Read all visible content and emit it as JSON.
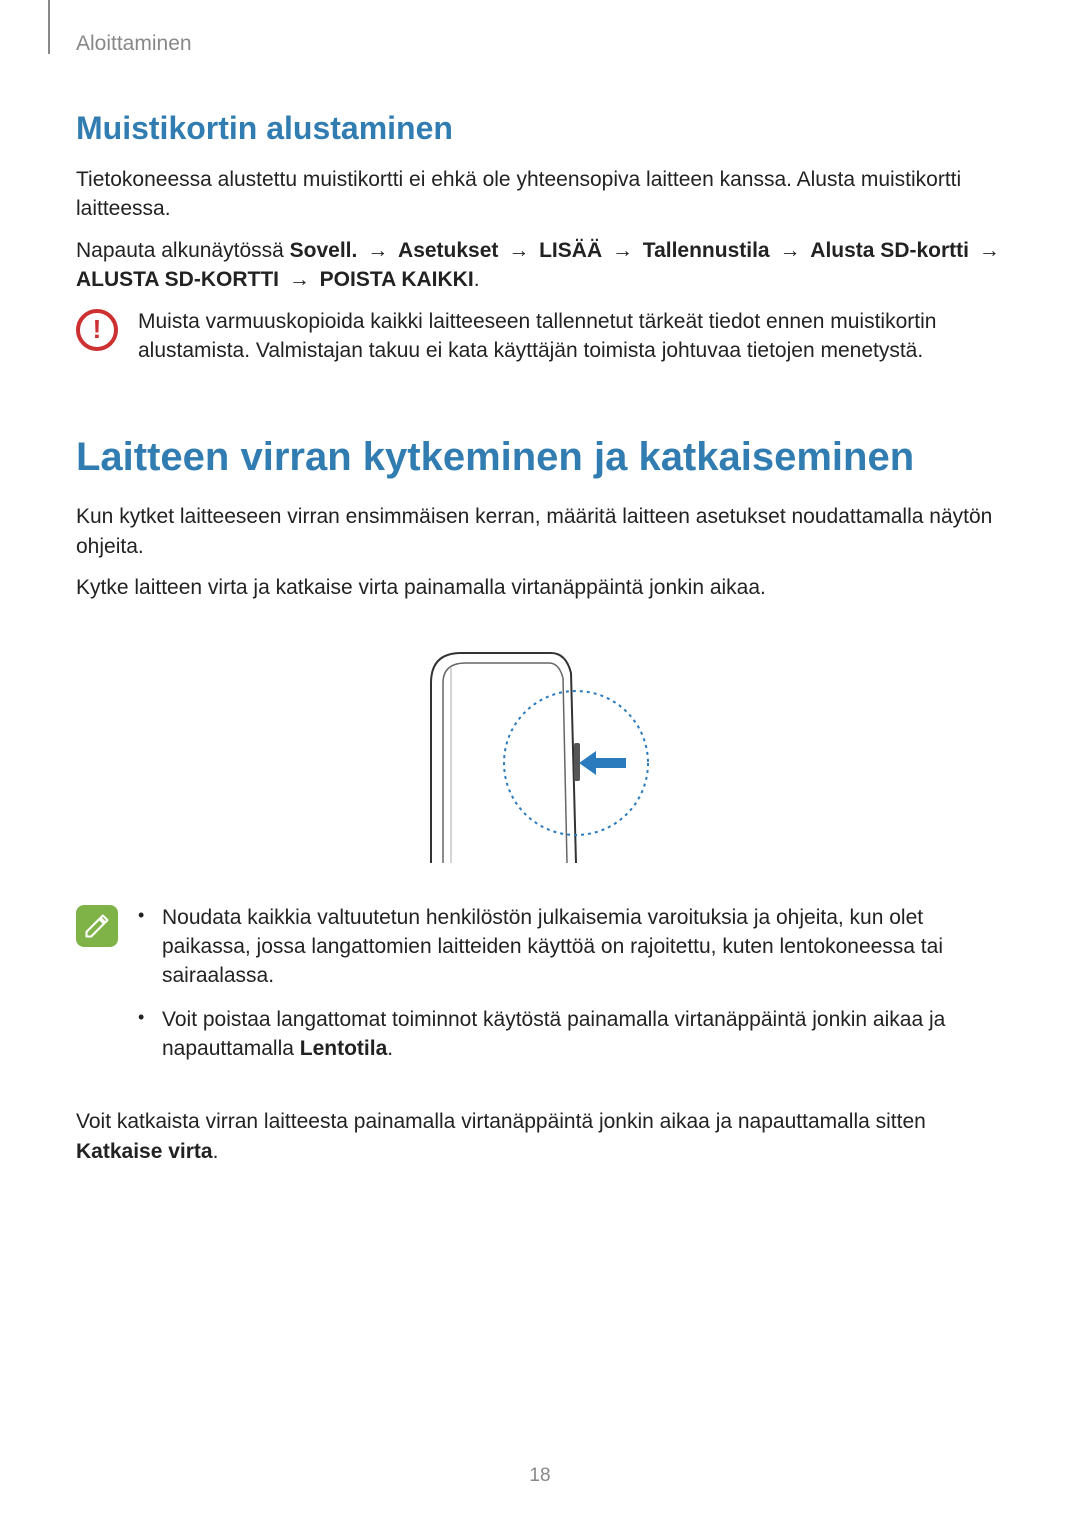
{
  "header": {
    "section": "Aloittaminen"
  },
  "section1": {
    "title": "Muistikortin alustaminen",
    "p1": "Tietokoneessa alustettu muistikortti ei ehkä ole yhteensopiva laitteen kanssa. Alusta muistikortti laitteessa.",
    "p2_prefix": "Napauta alkunäytössä ",
    "p2_bold1": "Sovell.",
    "arrow": "→",
    "p2_bold2": "Asetukset",
    "p2_bold3": "LISÄÄ",
    "p2_bold4": "Tallennustila",
    "p2_bold5": "Alusta SD-kortti",
    "p2_bold6": "ALUSTA SD-KORTTI",
    "p2_bold7": "POISTA KAIKKI",
    "warning": "Muista varmuuskopioida kaikki laitteeseen tallennetut tärkeät tiedot ennen muistikortin alustamista. Valmistajan takuu ei kata käyttäjän toimista johtuvaa tietojen menetystä."
  },
  "section2": {
    "title": "Laitteen virran kytkeminen ja katkaiseminen",
    "p1": "Kun kytket laitteeseen virran ensimmäisen kerran, määritä laitteen asetukset noudattamalla näytön ohjeita.",
    "p2": "Kytke laitteen virta ja katkaise virta painamalla virtanäppäintä jonkin aikaa.",
    "note_bullet1": "Noudata kaikkia valtuutetun henkilöstön julkaisemia varoituksia ja ohjeita, kun olet paikassa, jossa langattomien laitteiden käyttöä on rajoitettu, kuten lentokoneessa tai sairaalassa.",
    "note_bullet2_prefix": "Voit poistaa langattomat toiminnot käytöstä painamalla virtanäppäintä jonkin aikaa ja napauttamalla ",
    "note_bullet2_bold": "Lentotila",
    "p3_prefix": "Voit katkaista virran laitteesta painamalla virtanäppäintä jonkin aikaa ja napauttamalla sitten ",
    "p3_bold": "Katkaise virta"
  },
  "page_number": "18"
}
